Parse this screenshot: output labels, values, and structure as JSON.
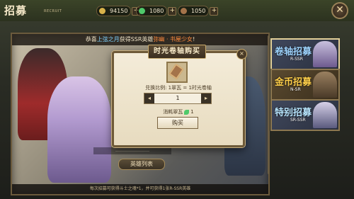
{
  "header": {
    "title": "招募",
    "subtitle": "RECRUIT",
    "resources": [
      {
        "name": "gold-coin",
        "value": "94150",
        "color": "#d8b24a"
      },
      {
        "name": "jade-gem",
        "value": "1080",
        "color": "#4fc96a"
      },
      {
        "name": "time-scroll",
        "value": "1050",
        "color": "#a4734a"
      }
    ]
  },
  "banner": {
    "text_pre": "恭喜",
    "player": "上弦之月",
    "text_mid": "获得SSR英雄",
    "hero": "弥幽 · 书屋少女",
    "text_post": "!"
  },
  "main": {
    "hint_text": "……………………",
    "hero_list_button": "英雄列表",
    "bottom_note": "每次招募可获得斗士之魂*1，并可获得1张R-SSR英雄"
  },
  "tabs": [
    {
      "name": "卷轴招募",
      "rank": "R-SSR",
      "color": "#9ed4ff",
      "selected": true
    },
    {
      "name": "金币招募",
      "rank": "N-SR",
      "color": "#ffcf4a",
      "selected": false
    },
    {
      "name": "特别招募",
      "rank": "SR-SSR",
      "color": "#b8e6ff",
      "selected": false
    }
  ],
  "modal": {
    "title": "时光卷轴购买",
    "close_label": "×",
    "ratio": "兑换比例: 1翠瓦 = 1时光卷轴",
    "quantity": "1",
    "dec_label": "◂",
    "inc_label": "▸",
    "cost_label": "消耗翠瓦",
    "cost_value": "1",
    "buy_label": "购买"
  }
}
